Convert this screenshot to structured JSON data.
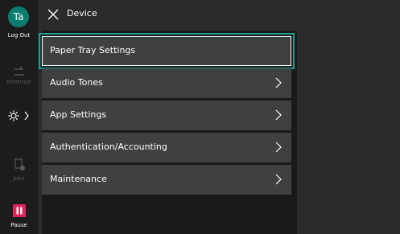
{
  "left_rail": {
    "avatar_text": "Ta",
    "logout_label": "Log Out",
    "interrupt_label": "Interrupt",
    "jobs_label": "Jobs",
    "pause_label": "Pause",
    "pause_color": "#e0245e",
    "accent_color": "#0a7d6e"
  },
  "header": {
    "title": "Device",
    "close_icon": "close-icon"
  },
  "menu": {
    "items": [
      {
        "label": "Paper Tray Settings",
        "selected": true,
        "has_chevron": false
      },
      {
        "label": "Audio Tones",
        "selected": false,
        "has_chevron": true
      },
      {
        "label": "App Settings",
        "selected": false,
        "has_chevron": true
      },
      {
        "label": "Authentication/Accounting",
        "selected": false,
        "has_chevron": true
      },
      {
        "label": "Maintenance",
        "selected": false,
        "has_chevron": true
      }
    ]
  }
}
